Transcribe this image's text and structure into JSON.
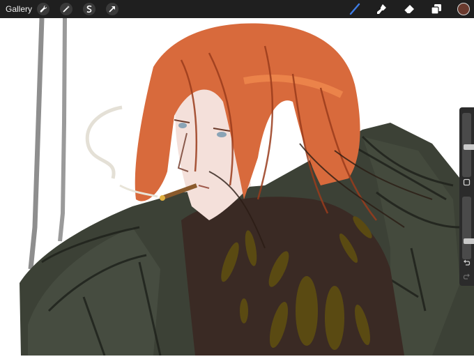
{
  "toolbar": {
    "gallery_label": "Gallery",
    "left_tools": [
      {
        "icon": "wrench-icon",
        "name": "actions"
      },
      {
        "icon": "magic-wand-icon",
        "name": "adjustments"
      },
      {
        "icon": "selection-s-icon",
        "name": "selection"
      },
      {
        "icon": "transform-arrow-icon",
        "name": "transform"
      }
    ],
    "right_tools": [
      {
        "icon": "brush-icon",
        "name": "paint",
        "active": true
      },
      {
        "icon": "smudge-icon",
        "name": "smudge"
      },
      {
        "icon": "eraser-icon",
        "name": "eraser"
      },
      {
        "icon": "layers-icon",
        "name": "layers"
      }
    ],
    "current_color": "#6a3a2e",
    "active_tool_color": "#3f7de6"
  },
  "sidebar": {
    "brush_size_level": 0.47,
    "opacity_level": 0.27,
    "modify_button_icon": "square-icon",
    "undo_icon": "undo-icon",
    "redo_icon": "redo-icon"
  },
  "canvas": {
    "subject": "painting",
    "palette": {
      "hair": "#d86a3c",
      "hair_dark": "#b64a26",
      "skin": "#f4e0da",
      "coat": "#3c4136",
      "coat_light": "#4a5243",
      "sweater": "#3a2a24",
      "pattern": "#5a4a12",
      "bars": "#9a9a9a"
    }
  }
}
